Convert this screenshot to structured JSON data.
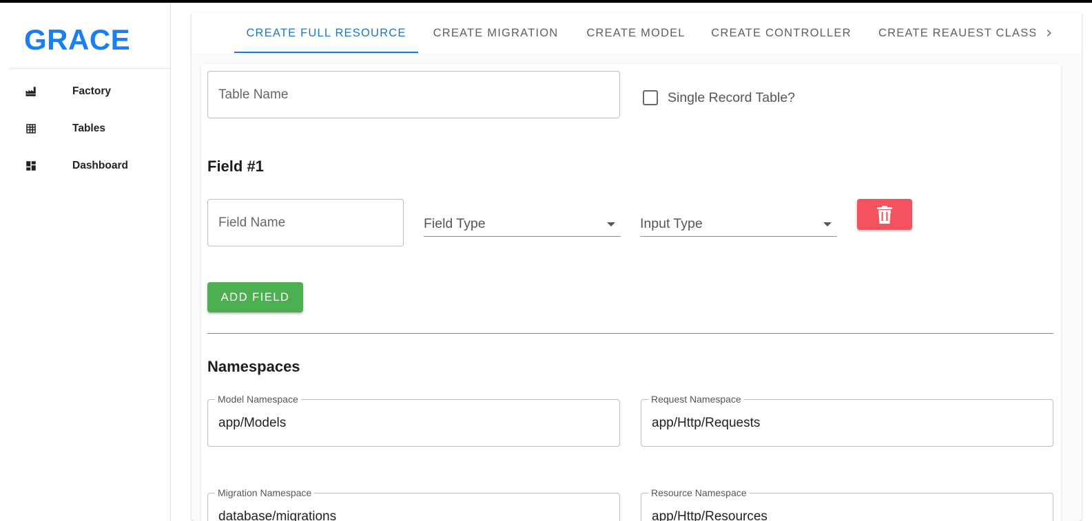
{
  "app": {
    "brand": "GRACE"
  },
  "sidebar": {
    "items": [
      {
        "label": "Factory",
        "icon": "factory-icon"
      },
      {
        "label": "Tables",
        "icon": "table-icon"
      },
      {
        "label": "Dashboard",
        "icon": "dashboard-icon"
      }
    ]
  },
  "tabs": [
    {
      "label": "CREATE FULL RESOURCE",
      "active": true
    },
    {
      "label": "CREATE MIGRATION",
      "active": false
    },
    {
      "label": "CREATE MODEL",
      "active": false
    },
    {
      "label": "CREATE CONTROLLER",
      "active": false
    },
    {
      "label": "CREATE REAUEST CLASS",
      "active": false
    }
  ],
  "form": {
    "table_name_placeholder": "Table Name",
    "single_record_label": "Single Record Table?",
    "single_record_checked": false,
    "field_heading": "Field #1",
    "field_name_placeholder": "Field Name",
    "field_type_placeholder": "Field Type",
    "input_type_placeholder": "Input Type",
    "add_field_label": "ADD FIELD",
    "namespaces_heading": "Namespaces",
    "model_ns_label": "Model Namespace",
    "model_ns_value": "app/Models",
    "request_ns_label": "Request Namespace",
    "request_ns_value": "app/Http/Requests",
    "migration_ns_label": "Migration Namespace",
    "migration_ns_value": "database/migrations",
    "resource_ns_label": "Resource Namespace",
    "resource_ns_value": "app/Http/Resources"
  },
  "colors": {
    "brand": "#1a7ff0",
    "tab_active": "#1976d2",
    "danger": "#f4535e",
    "success": "#4caf50"
  }
}
